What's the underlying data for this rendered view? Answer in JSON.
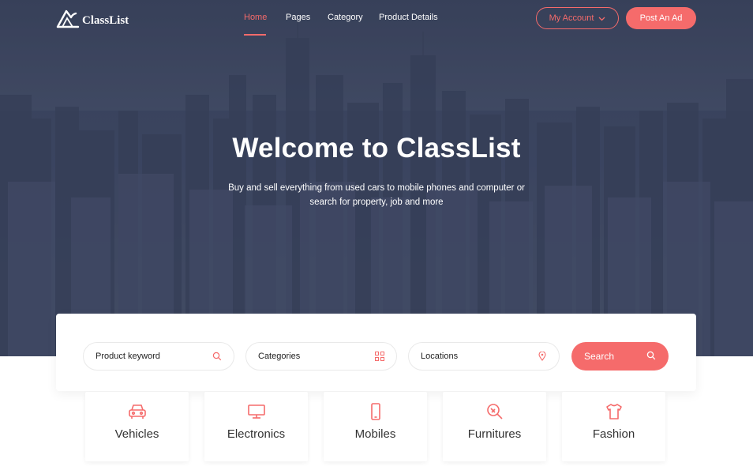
{
  "brand": {
    "name": "ClassList"
  },
  "nav": {
    "links": [
      {
        "label": "Home",
        "active": true
      },
      {
        "label": "Pages"
      },
      {
        "label": "Category"
      },
      {
        "label": "Product Details"
      }
    ],
    "account_label": "My Account",
    "post_ad_label": "Post An Ad"
  },
  "hero": {
    "title": "Welcome to ClassList",
    "subtitle_line1": "Buy and sell everything from used cars to mobile phones and computer or",
    "subtitle_line2": "search for property, job and more"
  },
  "search": {
    "keyword_label": "Product keyword",
    "categories_label": "Categories",
    "locations_label": "Locations",
    "button_label": "Search"
  },
  "categories": [
    {
      "label": "Vehicles",
      "icon": "car-icon"
    },
    {
      "label": "Electronics",
      "icon": "monitor-icon"
    },
    {
      "label": "Mobiles",
      "icon": "mobile-icon"
    },
    {
      "label": "Furnitures",
      "icon": "furniture-icon"
    },
    {
      "label": "Fashion",
      "icon": "tshirt-icon"
    }
  ],
  "colors": {
    "accent": "#f56b6b",
    "hero_overlay": "#3f4a66",
    "text_dark": "#333333"
  }
}
